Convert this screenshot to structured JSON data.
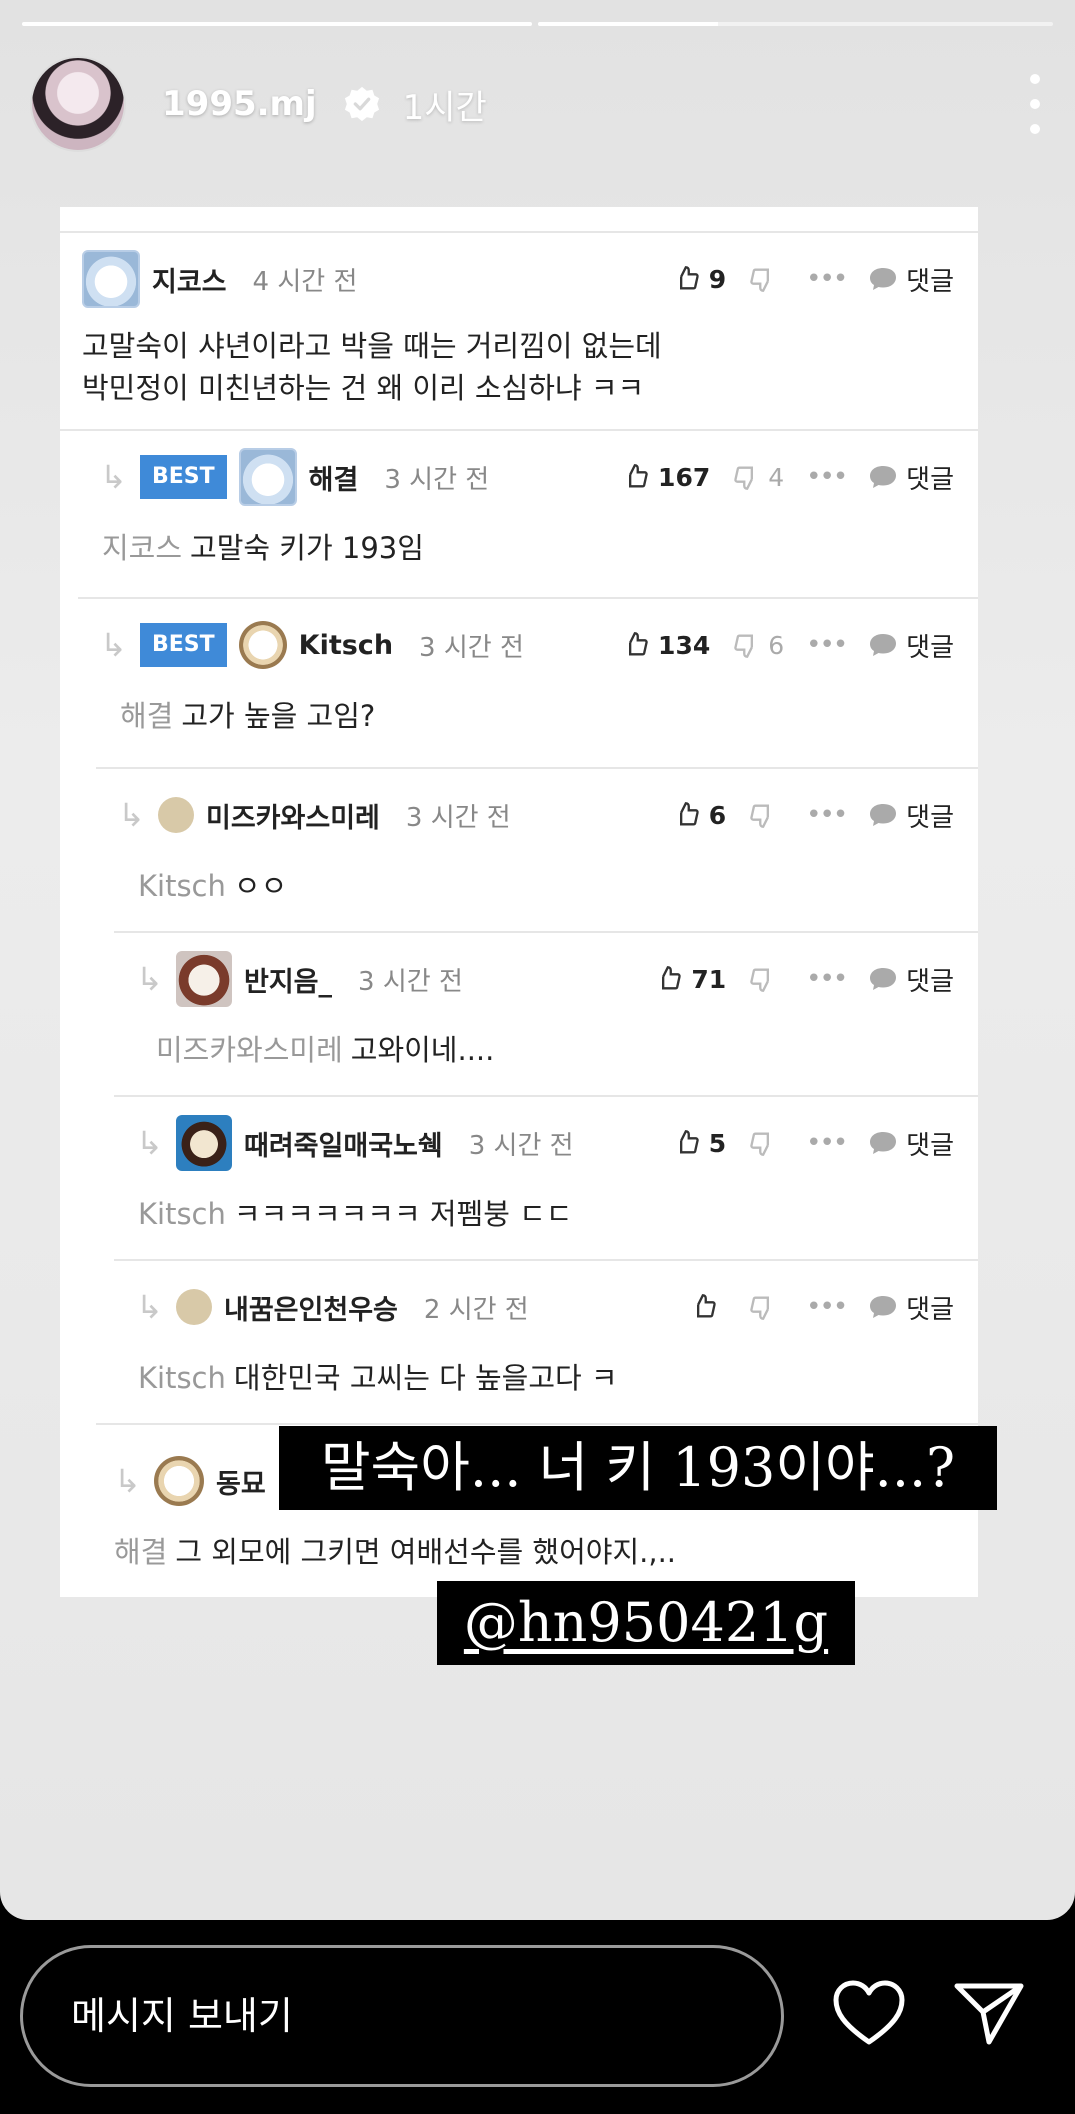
{
  "story": {
    "username": "1995.mj",
    "time": "1시간",
    "progress": [
      1.0,
      0.35
    ],
    "colors": {
      "verified": "#ffffff",
      "best_badge": "#3f8ad8"
    }
  },
  "comments": [
    {
      "best": false,
      "nick": "지코스",
      "ago": "4 시간 전",
      "likes": "9",
      "dislikes": "",
      "reply_label": "댓글",
      "mention": "",
      "text": "고말숙이 샤년이라고 박을 때는 거리낌이 없는데\n박민정이 미친년하는 건 왜 이리 소심하냐 ㅋㅋ"
    },
    {
      "best": true,
      "best_label": "BEST",
      "nick": "해결",
      "ago": "3 시간 전",
      "likes": "167",
      "dislikes": "4",
      "reply_label": "댓글",
      "mention": "지코스",
      "text": "고말숙 키가 193임"
    },
    {
      "best": true,
      "best_label": "BEST",
      "nick": "Kitsch",
      "ago": "3 시간 전",
      "likes": "134",
      "dislikes": "6",
      "reply_label": "댓글",
      "mention": "해결",
      "text": "고가 높을 고임?"
    },
    {
      "best": false,
      "nick": "미즈카와스미레",
      "ago": "3 시간 전",
      "likes": "6",
      "dislikes": "",
      "reply_label": "댓글",
      "mention": "Kitsch",
      "text": "ㅇㅇ"
    },
    {
      "best": false,
      "nick": "반지음_",
      "ago": "3 시간 전",
      "likes": "71",
      "dislikes": "",
      "reply_label": "댓글",
      "mention": "미즈카와스미레",
      "text": "고와이네...."
    },
    {
      "best": false,
      "nick": "때려죽일매국노쉑",
      "ago": "3 시간 전",
      "likes": "5",
      "dislikes": "",
      "reply_label": "댓글",
      "mention": "Kitsch",
      "text": "ㅋㅋㅋㅋㅋㅋㅋ 저펨붕 ㄷㄷ"
    },
    {
      "best": false,
      "nick": "내꿈은인천우승",
      "ago": "2 시간 전",
      "likes": "",
      "dislikes": "",
      "reply_label": "댓글",
      "mention": "Kitsch",
      "text": "대한민국 고씨는 다 높을고다 ㅋ"
    },
    {
      "best": false,
      "nick": "동묘",
      "ago": "",
      "likes": "",
      "dislikes": "",
      "reply_label": "",
      "mention": "해결",
      "text": "그 외모에 그키면 여배선수를 했어야지.,.."
    }
  ],
  "captions": {
    "main": "말숙아... 너 키 193이야...?",
    "handle": "@hn950421g"
  },
  "footer": {
    "message_placeholder": "메시지 보내기",
    "icons": [
      "heart-icon",
      "send-icon"
    ]
  }
}
